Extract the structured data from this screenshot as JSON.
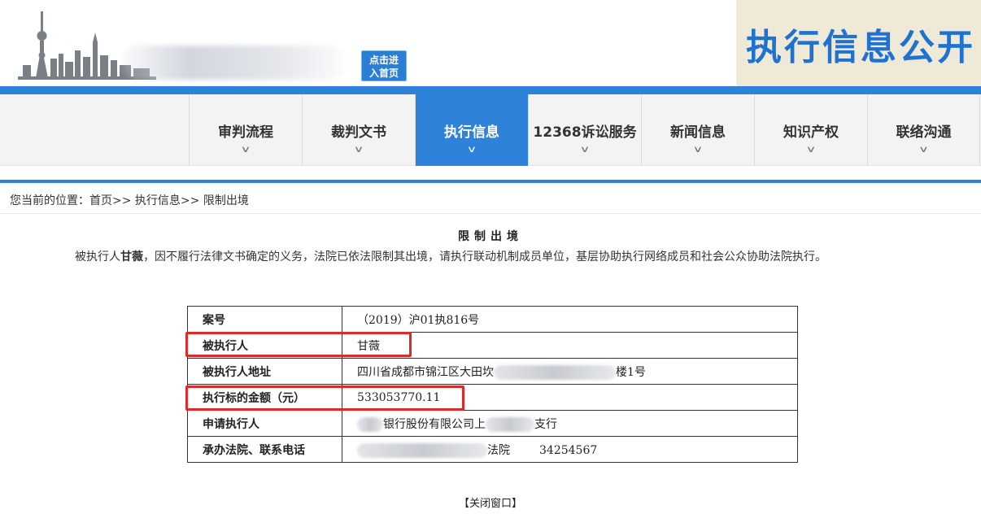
{
  "header": {
    "home_button": [
      "点击进",
      "入首页"
    ],
    "title": "执行信息公开"
  },
  "nav": {
    "items": [
      {
        "label": "审判流程",
        "active": false
      },
      {
        "label": "裁判文书",
        "active": false
      },
      {
        "label": "执行信息",
        "active": true
      },
      {
        "label": "12368诉讼服务",
        "active": false
      },
      {
        "label": "新闻信息",
        "active": false
      },
      {
        "label": "知识产权",
        "active": false
      },
      {
        "label": "联络沟通",
        "active": false
      }
    ]
  },
  "breadcrumb": "您当前的位置：首页>> 执行信息>> 限制出境",
  "article": {
    "title": "限制出境",
    "para_prefix": "被执行人",
    "para_name": "甘薇",
    "para_suffix": "，因不履行法律文书确定的义务，法院已依法限制其出境，请执行联动机制成员单位，基层协助执行网络成员和社会公众协助法院执行。"
  },
  "table": {
    "rows": [
      {
        "key": "案号",
        "value": "（2019）沪01执816号"
      },
      {
        "key": "被执行人",
        "value": "甘薇"
      },
      {
        "key": "被执行人地址",
        "value_a": "四川省成都市锦江区大田坎",
        "value_b": "楼1号"
      },
      {
        "key": "执行标的金额（元）",
        "value": "533053770.11"
      },
      {
        "key": "申请执行人",
        "value_a": "银行股份有限公司上",
        "value_b": "支行"
      },
      {
        "key": "承办法院、联系电话",
        "value_a": "法院",
        "value_b": "34254567"
      }
    ]
  },
  "close_link": "【关闭窗口】",
  "colors": {
    "accent": "#2f82da",
    "title_blue": "#1f72d0",
    "highlight_red": "#e02a2a"
  }
}
